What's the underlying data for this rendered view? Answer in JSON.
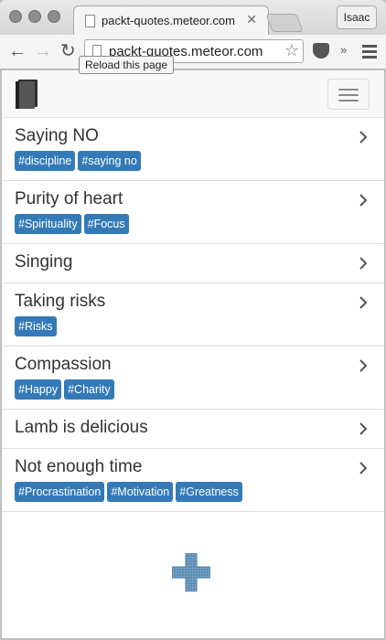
{
  "browser": {
    "tab_title": "packt-quotes.meteor.com",
    "tab_close": "✕",
    "profile_name": "Isaac",
    "url": "packt-quotes.meteor.com",
    "tooltip": "Reload this page",
    "nav": {
      "back": "←",
      "forward": "→",
      "reload": "↻",
      "bookmark": "☆",
      "more": "»"
    }
  },
  "icons": {
    "logo": "book-icon",
    "menu": "hamburger-icon",
    "row_arrow": "chevron-right-icon",
    "add": "plus-icon"
  },
  "colors": {
    "tag_bg": "#337ab7",
    "add_button": "#5f8fb4",
    "navbar_bg": "#f8f8f8"
  },
  "quotes": [
    {
      "title": "Saying NO",
      "tags": [
        "#discipline",
        "#saying no"
      ]
    },
    {
      "title": "Purity of heart",
      "tags": [
        "#Spirituality",
        "#Focus"
      ]
    },
    {
      "title": "Singing",
      "tags": []
    },
    {
      "title": "Taking risks",
      "tags": [
        "#Risks"
      ]
    },
    {
      "title": "Compassion",
      "tags": [
        "#Happy",
        "#Charity"
      ]
    },
    {
      "title": "Lamb is delicious",
      "tags": []
    },
    {
      "title": "Not enough time",
      "tags": [
        "#Procrastination",
        "#Motivation",
        "#Greatness"
      ]
    }
  ]
}
